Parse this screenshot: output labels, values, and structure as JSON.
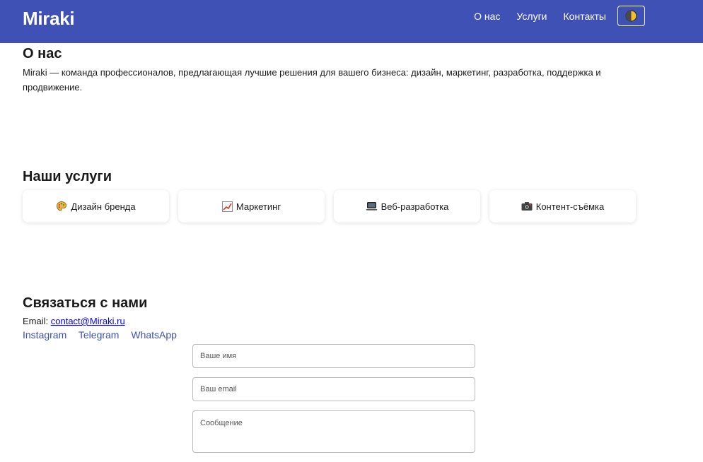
{
  "header": {
    "logo": "Miraki",
    "nav": [
      "О нас",
      "Услуги",
      "Контакты"
    ],
    "theme_toggle_icon": "half-moon-icon"
  },
  "about": {
    "title": "О нас",
    "text": "Miraki — команда профессионалов, предлагающая лучшие решения для вашего бизнеса: дизайн, маркетинг, разработка, поддержка и продвижение."
  },
  "services": {
    "title": "Наши услуги",
    "items": [
      {
        "icon": "palette-icon",
        "label": "Дизайн бренда"
      },
      {
        "icon": "chart-up-icon",
        "label": "Маркетинг"
      },
      {
        "icon": "laptop-icon",
        "label": "Веб-разработка"
      },
      {
        "icon": "camera-icon",
        "label": "Контент-съёмка"
      }
    ]
  },
  "contact": {
    "title": "Связаться с нами",
    "email_label": "Email:",
    "email": "contact@Miraki.ru",
    "socials": [
      "Instagram",
      "Telegram",
      "WhatsApp"
    ],
    "form": {
      "name_placeholder": "Ваше имя",
      "email_placeholder": "Ваш email",
      "message_placeholder": "Сообщение"
    }
  },
  "colors": {
    "header_bg": "#3f51b5",
    "link": "#3f51b5",
    "email_link": "#0000ee"
  }
}
